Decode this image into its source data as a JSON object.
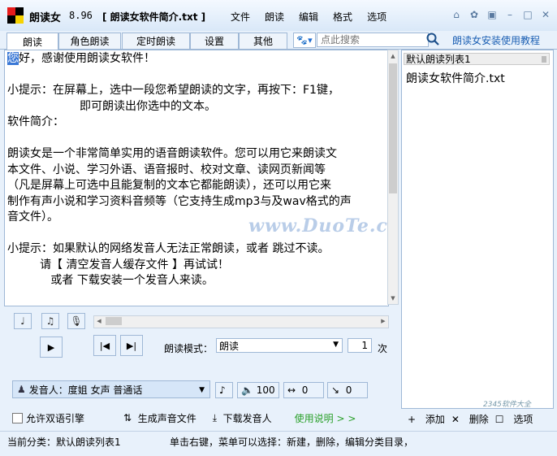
{
  "titlebar": {
    "app_name": "朗读女",
    "version": "8.96",
    "document": "[ 朗读女软件简介.txt ]",
    "menu": [
      "文件",
      "朗读",
      "编辑",
      "格式",
      "选项"
    ]
  },
  "tabs": [
    "朗读",
    "角色朗读",
    "定时朗读",
    "设置",
    "其他"
  ],
  "search": {
    "placeholder": "点此搜索"
  },
  "tutorial_link": "朗读女安装使用教程",
  "editor": {
    "first_char": "您",
    "lines": [
      "好，感谢使用朗读女软件！",
      "",
      "小提示：在屏幕上，选中一段您希望朗读的文字，再按下：F1键，",
      "                    即可朗读出你选中的文本。",
      "软件简介：",
      "",
      "朗读女是一个非常简单实用的语音朗读软件。您可以用它来朗读文",
      "本文件、小说、学习外语、语音报时、校对文章、读网页新闻等",
      "（凡是屏幕上可选中且能复制的文本它都能朗读），还可以用它来",
      "制作有声小说和学习资料音频等（它支持生成mp3与及wav格式的声",
      "音文件）。",
      "",
      "小提示：如果默认的网络发音人无法正常朗读，或者 跳过不读。",
      "         请【 清空发音人缓存文件 】再试试！",
      "            或者 下载安装一个发音人来读。"
    ]
  },
  "watermark": "www.DuoTe.com",
  "right_panel": {
    "list_select": "默认朗读列表1",
    "items": [
      "朗读女软件简介.txt"
    ],
    "footer": {
      "add": "添加",
      "delete": "删除",
      "options": "选项"
    }
  },
  "controls": {
    "mode_label": "朗读模式：",
    "mode_value": "朗读",
    "repeat_count": "1",
    "repeat_unit": "次",
    "voice_label": "发音人：度姐 女声 普通话",
    "volume": "100",
    "speed": "0",
    "pitch": "0"
  },
  "bottom_row": {
    "bilingual": "允许双语引擎",
    "generate_audio": "生成声音文件",
    "download_voice": "下载发音人",
    "help": "使用说明 > >"
  },
  "statusbar": {
    "category": "当前分类：默认朗读列表1",
    "hint": "单击右键，菜单可以选择：新建，删除，编辑分类目录，"
  },
  "corner_mark": "2345软件大全"
}
